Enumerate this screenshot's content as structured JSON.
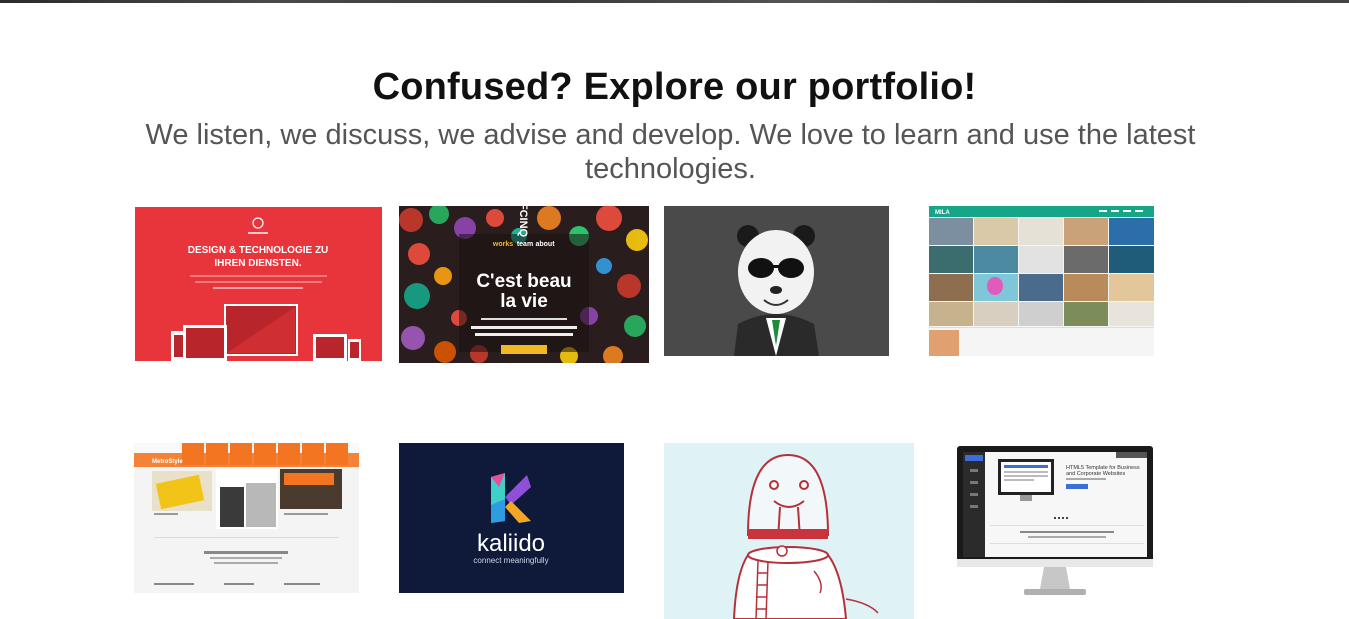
{
  "section": {
    "heading": "Confused? Explore our portfolio!",
    "subtitle": "We listen, we discuss, we advise and develop. We love to learn and use the latest technologies."
  },
  "portfolio": {
    "items": [
      {
        "title": "DESIGN & TECHNOLOGIE ZU",
        "title2": "IHREN DIENSTEN.",
        "accent": "#e8353b"
      },
      {
        "logo": "FCINQ",
        "nav": [
          "works",
          "team",
          "about"
        ],
        "headline": "C'est beau",
        "headline2": "la vie",
        "accent": "#f2b824"
      },
      {
        "subject": "panda-in-suit",
        "bg": "#4a4a4a"
      },
      {
        "logo": "MILA",
        "accent": "#17a589"
      },
      {
        "logo": "MetroStyle",
        "accent": "#f47521"
      },
      {
        "brand": "kaliido",
        "tagline": "connect meaningfully",
        "bg": "#0f1a3a"
      },
      {
        "subject": "walrus-illustration",
        "bg": "#dff2f5"
      },
      {
        "title": "HTML5 Template for Business",
        "title2": "and Corporate Websites",
        "accent": "#3a6fd8"
      }
    ]
  }
}
